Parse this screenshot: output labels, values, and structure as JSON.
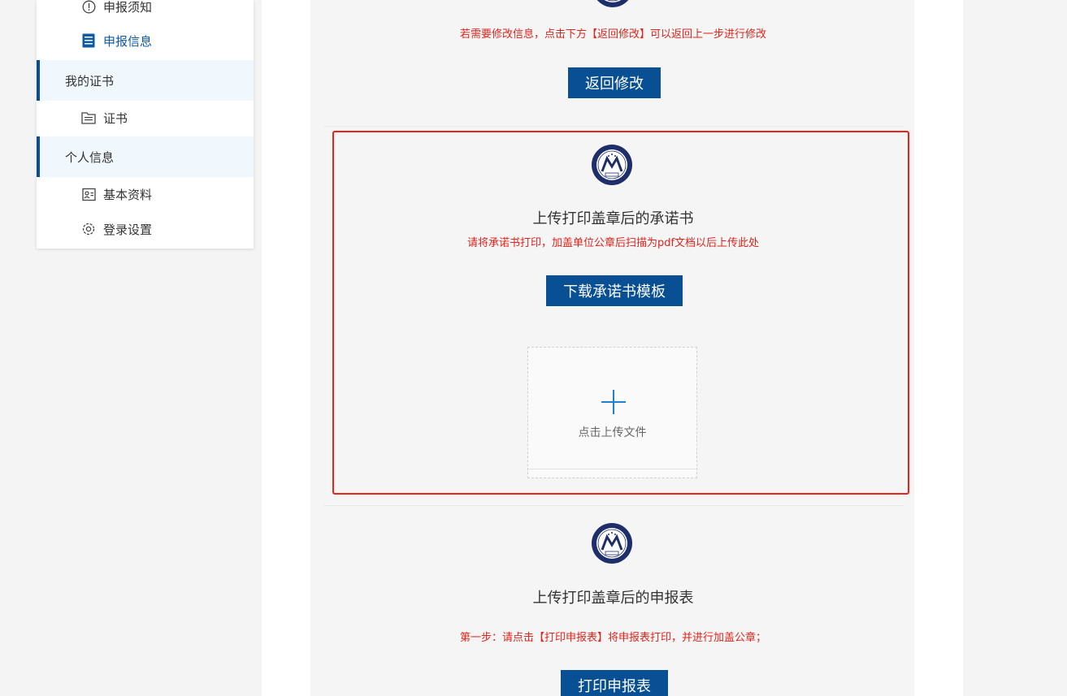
{
  "sidebar": {
    "items": [
      {
        "label": "申报须知",
        "icon": "info-circle-icon"
      },
      {
        "label": "申报信息",
        "icon": "document-list-icon",
        "active": true
      }
    ],
    "groups": [
      {
        "label": "我的证书",
        "items": [
          {
            "label": "证书",
            "icon": "certificate-icon"
          }
        ]
      },
      {
        "label": "个人信息",
        "items": [
          {
            "label": "基本资料",
            "icon": "profile-card-icon"
          },
          {
            "label": "登录设置",
            "icon": "gear-icon"
          }
        ]
      }
    ]
  },
  "section_modify": {
    "notice": "若需要修改信息，点击下方【返回修改】可以返回上一步进行修改",
    "button": "返回修改"
  },
  "section_commitment": {
    "title": "上传打印盖章后的承诺书",
    "notice": "请将承诺书打印，加盖单位公章后扫描为pdf文档以后上传此处",
    "button": "下载承诺书模板",
    "upload_label": "点击上传文件"
  },
  "section_form": {
    "title": "上传打印盖章后的申报表",
    "notice": "第一步：请点击【打印申报表】将申报表打印，并进行加盖公章；",
    "button": "打印申报表"
  },
  "colors": {
    "accent": "#084f93",
    "alert": "#e2231a",
    "highlight_border": "#e8231a"
  }
}
